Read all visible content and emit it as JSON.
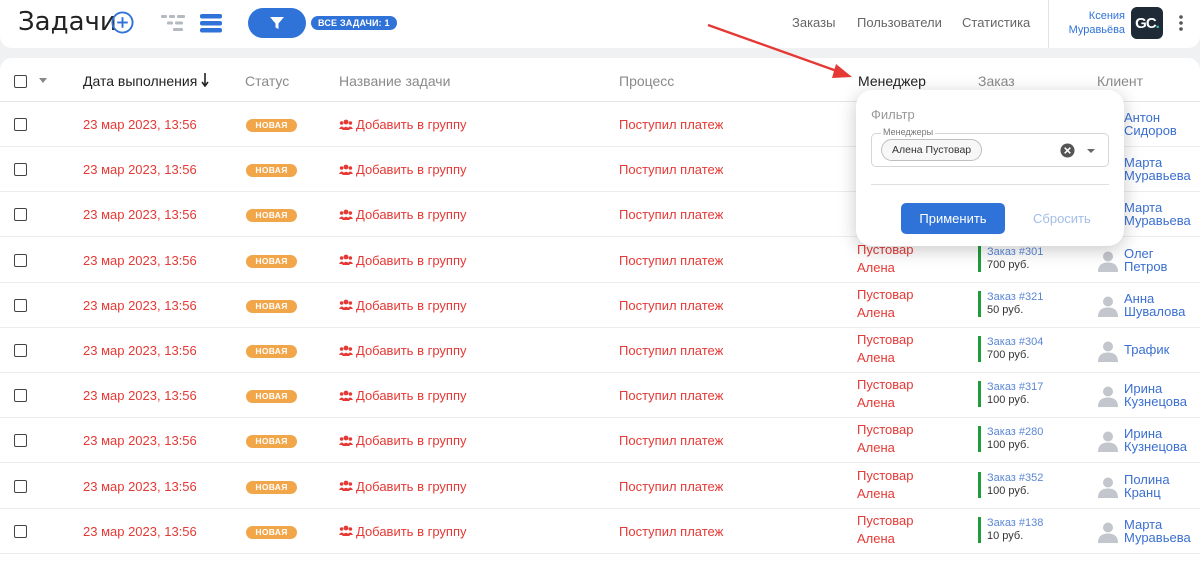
{
  "header": {
    "title": "Задачи",
    "filter_badge": "ВСЕ ЗАДАЧИ: 1",
    "nav": [
      "Заказы",
      "Пользователи",
      "Статистика"
    ],
    "user_first": "Ксения",
    "user_last": "Муравьёва",
    "avatar_initials": "GC",
    "avatar_dot": "."
  },
  "table": {
    "columns": {
      "date": "Дата выполнения",
      "status": "Статус",
      "name": "Название задачи",
      "process": "Процесс",
      "manager": "Менеджер",
      "order": "Заказ",
      "client": "Клиент"
    },
    "rows": [
      {
        "date": "23 мар 2023, 13:56",
        "status": "НОВАЯ",
        "task": "Добавить в группу",
        "process": "Поступил платеж",
        "manager_last": "",
        "manager_first": "",
        "order_num": "",
        "order_sum": "",
        "client_first": "Антон",
        "client_last": "Сидоров"
      },
      {
        "date": "23 мар 2023, 13:56",
        "status": "НОВАЯ",
        "task": "Добавить в группу",
        "process": "Поступил платеж",
        "manager_last": "",
        "manager_first": "",
        "order_num": "",
        "order_sum": "",
        "client_first": "Марта",
        "client_last": "Муравьева"
      },
      {
        "date": "23 мар 2023, 13:56",
        "status": "НОВАЯ",
        "task": "Добавить в группу",
        "process": "Поступил платеж",
        "manager_last": "",
        "manager_first": "",
        "order_num": "",
        "order_sum": "",
        "client_first": "Марта",
        "client_last": "Муравьева"
      },
      {
        "date": "23 мар 2023, 13:56",
        "status": "НОВАЯ",
        "task": "Добавить в группу",
        "process": "Поступил платеж",
        "manager_last": "Пустовар",
        "manager_first": "Алена",
        "order_num": "Заказ #301",
        "order_sum": "700 руб.",
        "client_first": "Олег",
        "client_last": "Петров"
      },
      {
        "date": "23 мар 2023, 13:56",
        "status": "НОВАЯ",
        "task": "Добавить в группу",
        "process": "Поступил платеж",
        "manager_last": "Пустовар",
        "manager_first": "Алена",
        "order_num": "Заказ #321",
        "order_sum": "50 руб.",
        "client_first": "Анна",
        "client_last": "Шувалова"
      },
      {
        "date": "23 мар 2023, 13:56",
        "status": "НОВАЯ",
        "task": "Добавить в группу",
        "process": "Поступил платеж",
        "manager_last": "Пустовар",
        "manager_first": "Алена",
        "order_num": "Заказ #304",
        "order_sum": "700 руб.",
        "client_first": "Трафик",
        "client_last": ""
      },
      {
        "date": "23 мар 2023, 13:56",
        "status": "НОВАЯ",
        "task": "Добавить в группу",
        "process": "Поступил платеж",
        "manager_last": "Пустовар",
        "manager_first": "Алена",
        "order_num": "Заказ #317",
        "order_sum": "100 руб.",
        "client_first": "Ирина",
        "client_last": "Кузнецова"
      },
      {
        "date": "23 мар 2023, 13:56",
        "status": "НОВАЯ",
        "task": "Добавить в группу",
        "process": "Поступил платеж",
        "manager_last": "Пустовар",
        "manager_first": "Алена",
        "order_num": "Заказ #280",
        "order_sum": "100 руб.",
        "client_first": "Ирина",
        "client_last": "Кузнецова"
      },
      {
        "date": "23 мар 2023, 13:56",
        "status": "НОВАЯ",
        "task": "Добавить в группу",
        "process": "Поступил платеж",
        "manager_last": "Пустовар",
        "manager_first": "Алена",
        "order_num": "Заказ #352",
        "order_sum": "100 руб.",
        "client_first": "Полина",
        "client_last": "Кранц"
      },
      {
        "date": "23 мар 2023, 13:56",
        "status": "НОВАЯ",
        "task": "Добавить в группу",
        "process": "Поступил платеж",
        "manager_last": "Пустовар",
        "manager_first": "Алена",
        "order_num": "Заказ #138",
        "order_sum": "10 руб.",
        "client_first": "Марта",
        "client_last": "Муравьева"
      }
    ]
  },
  "filter_popup": {
    "title": "Фильтр",
    "field_label": "Менеджеры",
    "selected_chip": "Алена Пустовар",
    "apply": "Применить",
    "reset": "Сбросить"
  },
  "colors": {
    "accent": "#2f73d9",
    "danger": "#e53935",
    "status_new": "#f2a64a",
    "order_bar": "#1f9d3a",
    "annotation_arrow": "#e53935"
  },
  "icons": [
    "add-circle-icon",
    "tree-view-icon",
    "list-view-icon",
    "filter-icon",
    "kebab-menu-icon",
    "sort-down-icon",
    "group-users-icon",
    "user-silhouette-icon",
    "clear-icon",
    "dropdown-caret-icon"
  ]
}
